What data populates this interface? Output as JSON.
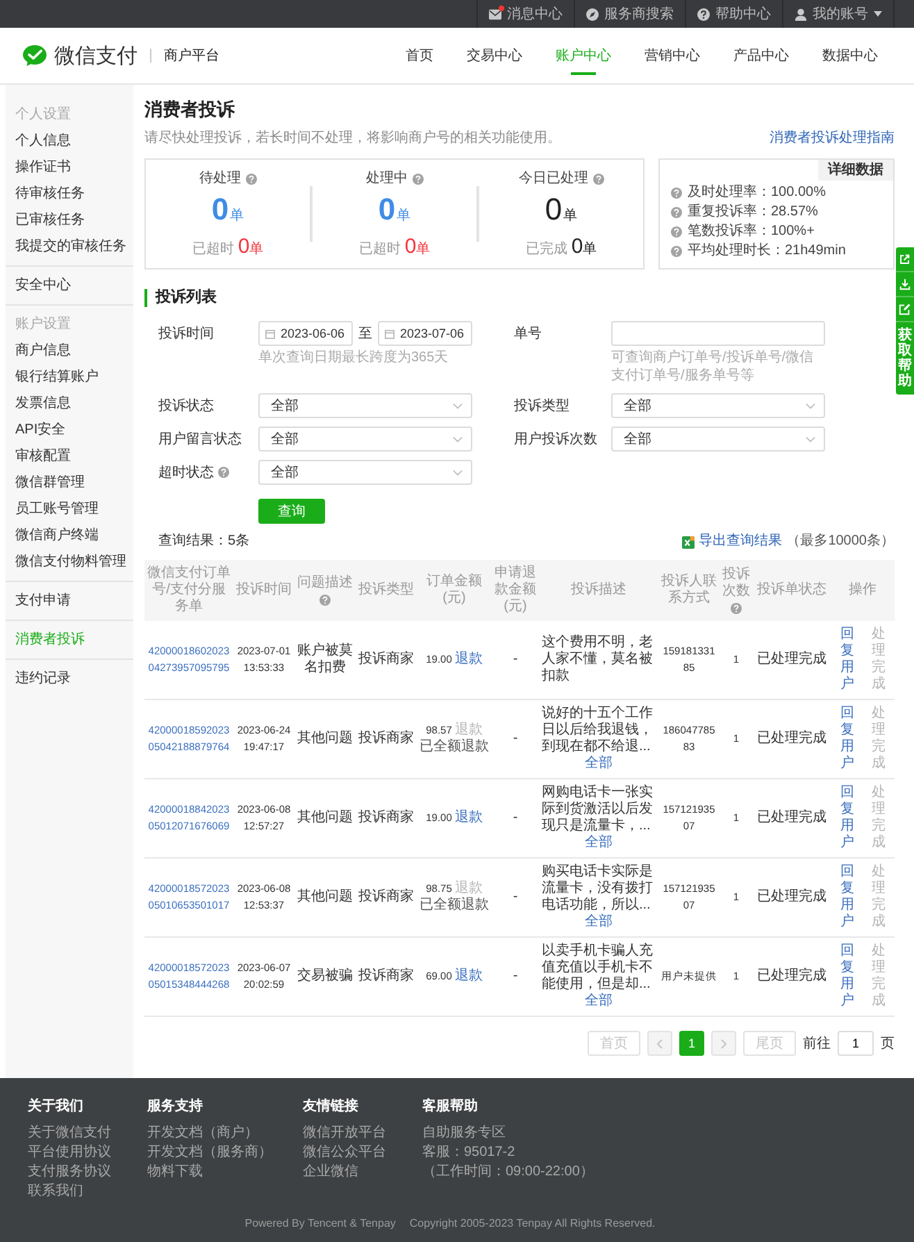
{
  "top_bar": {
    "items": [
      {
        "kind": "mail",
        "label": "消息中心",
        "unread": true,
        "dropdown": false
      },
      {
        "kind": "search",
        "label": "服务商搜索",
        "unread": false,
        "dropdown": false
      },
      {
        "kind": "help",
        "label": "帮助中心",
        "unread": false,
        "dropdown": false
      },
      {
        "kind": "account",
        "label": "我的账号",
        "unread": false,
        "dropdown": true
      }
    ]
  },
  "header": {
    "logo": "微信支付",
    "platform": "商户平台",
    "nav": [
      {
        "label": "首页",
        "selected": false
      },
      {
        "label": "交易中心",
        "selected": false
      },
      {
        "label": "账户中心",
        "selected": true
      },
      {
        "label": "营销中心",
        "selected": false
      },
      {
        "label": "产品中心",
        "selected": false
      },
      {
        "label": "数据中心",
        "selected": false
      }
    ]
  },
  "sidebar": {
    "groups": [
      {
        "title": "个人设置",
        "items": [
          {
            "label": "个人信息",
            "selected": false
          },
          {
            "label": "操作证书",
            "selected": false
          },
          {
            "label": "待审核任务",
            "selected": false
          },
          {
            "label": "已审核任务",
            "selected": false
          },
          {
            "label": "我提交的审核任务",
            "selected": false
          }
        ]
      },
      {
        "items": [
          {
            "label": "安全中心",
            "selected": false
          }
        ]
      },
      {
        "title": "账户设置",
        "items": [
          {
            "label": "商户信息",
            "selected": false
          },
          {
            "label": "银行结算账户",
            "selected": false
          },
          {
            "label": "发票信息",
            "selected": false
          },
          {
            "label": "API安全",
            "selected": false
          },
          {
            "label": "审核配置",
            "selected": false
          },
          {
            "label": "微信群管理",
            "selected": false
          },
          {
            "label": "员工账号管理",
            "selected": false
          },
          {
            "label": "微信商户终端",
            "selected": false
          },
          {
            "label": "微信支付物料管理",
            "selected": false
          }
        ]
      },
      {
        "items": [
          {
            "label": "支付申请",
            "selected": false
          }
        ]
      },
      {
        "items": [
          {
            "label": "消费者投诉",
            "selected": true
          }
        ]
      },
      {
        "items": [
          {
            "label": "违约记录",
            "selected": false
          }
        ]
      }
    ]
  },
  "page": {
    "title": "消费者投诉",
    "notice": "请尽快处理投诉，若长时间不处理，将影响商户号的相关功能使用。",
    "guide_link": "消费者投诉处理指南"
  },
  "summary": {
    "counters": [
      {
        "kind": "open",
        "label": "待处理",
        "help": true,
        "count": "0",
        "unit": "单",
        "sub_label": "已超时",
        "sub_count": "0",
        "sub_unit": "单"
      },
      {
        "kind": "open",
        "label": "处理中",
        "help": true,
        "count": "0",
        "unit": "单",
        "sub_label": "已超时",
        "sub_count": "0",
        "sub_unit": "单"
      },
      {
        "kind": "done",
        "label": "今日已处理",
        "help": true,
        "count": "0",
        "unit": "单",
        "sub_label": "已完成",
        "sub_count": "0",
        "sub_unit": "单"
      }
    ]
  },
  "stats": {
    "tag": "详细数据",
    "items": [
      "及时处理率：100.00%",
      "重复投诉率：28.57%",
      "笔数投诉率：100%+",
      "平均处理时长：21h49min"
    ]
  },
  "complaints": {
    "title": "投诉列表",
    "filters": [
      {
        "kind": "date_range",
        "label": "投诉时间",
        "help": false,
        "start": "2023-06-06",
        "separator": "至",
        "end": "2023-07-06",
        "hint": "单次查询日期最长跨度为365天"
      },
      {
        "kind": "text",
        "label": "单号",
        "help": false,
        "hint": "可查询商户订单号/投诉单号/微信支付订单号/服务单号等"
      },
      {
        "kind": "select",
        "label": "投诉状态",
        "help": false,
        "value": "全部"
      },
      {
        "kind": "select",
        "label": "投诉类型",
        "help": false,
        "value": "全部"
      },
      {
        "kind": "select",
        "label": "用户留言状态",
        "help": false,
        "value": "全部"
      },
      {
        "kind": "select",
        "label": "用户投诉次数",
        "help": false,
        "value": "全部"
      },
      {
        "kind": "select",
        "label": "超时状态",
        "help": true,
        "value": "全部"
      }
    ],
    "search_button": "查询",
    "result_count": "查询结果：5条",
    "export_link": "导出查询结果",
    "export_note": "（最多10000条）"
  },
  "table": {
    "columns": [
      {
        "label": "微信支付订单号/支付分服务单",
        "help": false
      },
      {
        "label": "投诉时间",
        "help": false
      },
      {
        "label": "问题描述",
        "help": true
      },
      {
        "label": "投诉类型",
        "help": false
      },
      {
        "label": "订单金额(元)",
        "help": false
      },
      {
        "label": "申请退款金额(元)",
        "help": false
      },
      {
        "label": "投诉描述",
        "help": false
      },
      {
        "label": "投诉人联系方式",
        "help": false
      },
      {
        "label": "投诉次数",
        "help": true
      },
      {
        "label": "投诉单状态",
        "help": false
      },
      {
        "label": "操作",
        "help": false
      }
    ],
    "rows": [
      {
        "order_id": "4200001860202304273957095795",
        "time": "2023-07-01 13:53:33",
        "issue": "账户被莫名扣费",
        "type": "投诉商家",
        "amount": "19.00",
        "refund": {
          "label": "退款",
          "disabled": false
        },
        "refund_amount": "-",
        "description": "这个费用不明，老人家不懂，莫名被扣款",
        "contact": "15918133185",
        "count": "1",
        "status": "已处理完成",
        "actions": [
          {
            "label": "回复用户",
            "disabled": false
          },
          {
            "label": "处理完成",
            "disabled": true
          }
        ]
      },
      {
        "order_id": "4200001859202305042188879764",
        "time": "2023-06-24 19:47:17",
        "issue": "其他问题",
        "type": "投诉商家",
        "amount": "98.57",
        "refund": {
          "label": "退款",
          "disabled": true
        },
        "refund_note": "已全额退款",
        "refund_amount": "-",
        "description": "说好的十五个工作日以后给我退钱，到现在都不给退...",
        "more": "全部",
        "contact": "18604778583",
        "count": "1",
        "status": "已处理完成",
        "actions": [
          {
            "label": "回复用户",
            "disabled": false
          },
          {
            "label": "处理完成",
            "disabled": true
          }
        ]
      },
      {
        "order_id": "4200001884202305012071676069",
        "time": "2023-06-08 12:57:27",
        "issue": "其他问题",
        "type": "投诉商家",
        "amount": "19.00",
        "refund": {
          "label": "退款",
          "disabled": false
        },
        "refund_amount": "-",
        "description": "网购电话卡一张实际到货激活以后发现只是流量卡，...",
        "more": "全部",
        "contact": "15712193507",
        "count": "1",
        "status": "已处理完成",
        "actions": [
          {
            "label": "回复用户",
            "disabled": false
          },
          {
            "label": "处理完成",
            "disabled": true
          }
        ]
      },
      {
        "order_id": "4200001857202305010653501017",
        "time": "2023-06-08 12:53:37",
        "issue": "其他问题",
        "type": "投诉商家",
        "amount": "98.75",
        "refund": {
          "label": "退款",
          "disabled": true
        },
        "refund_note": "已全额退款",
        "refund_amount": "-",
        "description": "购买电话卡实际是流量卡，没有拨打电话功能，所以...",
        "more": "全部",
        "contact": "15712193507",
        "count": "1",
        "status": "已处理完成",
        "actions": [
          {
            "label": "回复用户",
            "disabled": false
          },
          {
            "label": "处理完成",
            "disabled": true
          }
        ]
      },
      {
        "order_id": "4200001857202305015348444268",
        "time": "2023-06-07 20:02:59",
        "issue": "交易被骗",
        "type": "投诉商家",
        "amount": "69.00",
        "refund": {
          "label": "退款",
          "disabled": false
        },
        "refund_amount": "-",
        "description": "以卖手机卡骗人充值充值以手机卡不能使用，但是却...",
        "more": "全部",
        "contact": "用户未提供",
        "count": "1",
        "status": "已处理完成",
        "actions": [
          {
            "label": "回复用户",
            "disabled": false
          },
          {
            "label": "处理完成",
            "disabled": true
          }
        ]
      }
    ]
  },
  "pagination": {
    "first": {
      "label": "首页",
      "disabled": true
    },
    "prev_disabled": true,
    "pages": [
      {
        "label": "1",
        "selected": true
      }
    ],
    "next_disabled": true,
    "last": {
      "label": "尾页",
      "disabled": true
    },
    "goto_label": "前往",
    "goto_value": "1",
    "page_suffix": "页"
  },
  "footer": {
    "columns": [
      {
        "title": "关于我们",
        "links": [
          "关于微信支付",
          "平台使用协议",
          "支付服务协议",
          "联系我们"
        ]
      },
      {
        "title": "服务支持",
        "links": [
          "开发文档（商户）",
          "开发文档（服务商）",
          "物料下载"
        ]
      },
      {
        "title": "友情链接",
        "links": [
          "微信开放平台",
          "微信公众平台",
          "企业微信"
        ]
      },
      {
        "title": "客服帮助",
        "links": [
          "自助服务专区",
          "客服：95017-2",
          "（工作时间：09:00-22:00）"
        ]
      }
    ],
    "powered_by": "Powered By Tencent & Tenpay",
    "copyright": "Copyright 2005-2023 Tenpay All Rights Reserved."
  },
  "help_toolbar": {
    "label": "获取帮助"
  }
}
